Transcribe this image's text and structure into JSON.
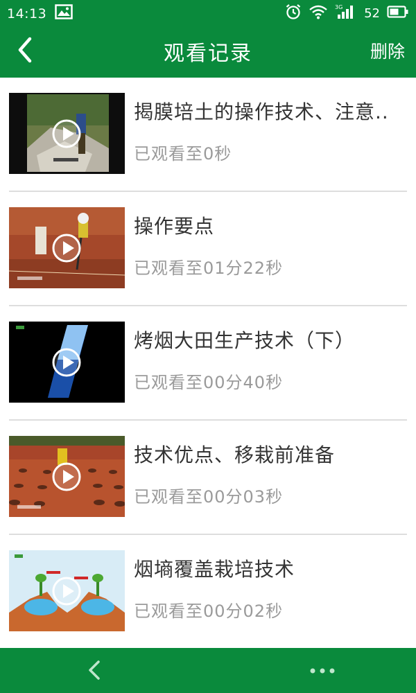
{
  "status_bar": {
    "time": "14:13",
    "battery": "52",
    "network": "3G",
    "icons": [
      "image-icon",
      "alarm-icon",
      "wifi-icon",
      "signal-icon",
      "battery-icon"
    ]
  },
  "header": {
    "title": "观看记录",
    "delete_label": "删除",
    "back_icon": "back-arrow-icon"
  },
  "history": [
    {
      "title": "揭膜培土的操作技术、注意..",
      "progress": "已观看至0秒"
    },
    {
      "title": "操作要点",
      "progress": "已观看至01分22秒"
    },
    {
      "title": "烤烟大田生产技术（下）",
      "progress": "已观看至00分40秒"
    },
    {
      "title": "技术优点、移栽前准备",
      "progress": "已观看至00分03秒"
    },
    {
      "title": "烟墒覆盖栽培技术",
      "progress": "已观看至00分02秒"
    }
  ],
  "nav_bar": {
    "icons": [
      "back-icon",
      "more-icon"
    ]
  },
  "colors": {
    "primary_green": "#0a8a3c",
    "title_text": "#333333",
    "progress_text": "#9a9a9a",
    "divider": "#dddddd"
  }
}
